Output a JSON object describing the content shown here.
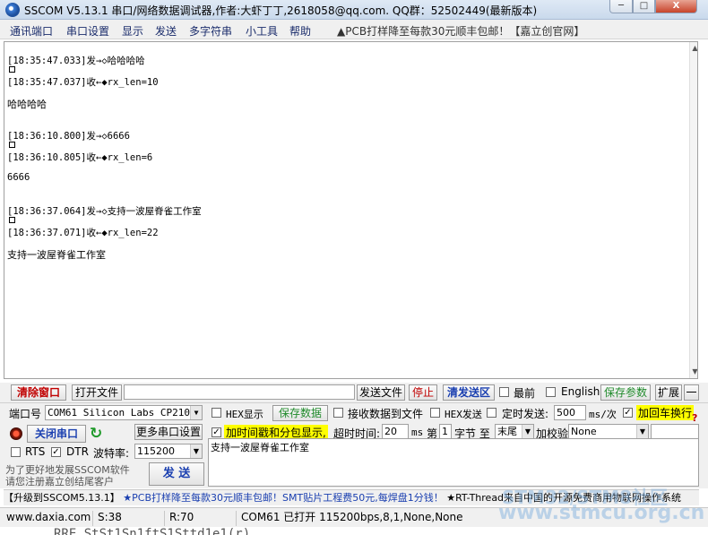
{
  "window": {
    "title": "SSCOM V5.13.1 串口/网络数据调试器,作者:大虾丁丁,2618058@qq.com. QQ群：52502449(最新版本)",
    "min_label": "─",
    "max_label": "□",
    "close_label": "X"
  },
  "menu": {
    "items": [
      "通讯端口",
      "串口设置",
      "显示",
      "发送",
      "多字符串",
      "小工具",
      "帮助"
    ],
    "promo": "▲PCB打样降至每款30元顺丰包邮！【嘉立创官网】"
  },
  "receive": {
    "lines": [
      "[18:35:47.033]发→◇哈哈哈哈",
      "[18:35:47.037]收←◆rx_len=10",
      "哈哈哈哈",
      "[18:36:10.800]发→◇6666",
      "[18:36:10.805]收←◆rx_len=6",
      "6666",
      "[18:36:37.064]发→◇支持一波屋脊雀工作室",
      "[18:36:37.071]收←◆rx_len=22",
      "支持一波屋脊雀工作室"
    ]
  },
  "toolbar": {
    "clear_window": "清除窗口",
    "open_file": "打开文件",
    "file_path": "",
    "send_file": "发送文件",
    "stop": "停止",
    "clear_send": "清发送区",
    "topmost": "最前",
    "english": "English",
    "save_params": "保存参数",
    "expand": "扩展",
    "collapse": "一"
  },
  "settings": {
    "port_label": "端口号",
    "port_value": "COM61 Silicon Labs CP210x",
    "hex_display": "HEX显示",
    "save_data": "保存数据",
    "recv_to_file": "接收数据到文件",
    "hex_send": "HEX发送",
    "timed_send": "定时发送:",
    "timed_interval": "500",
    "interval_unit": "ms/次",
    "add_crlf": "加回车换行",
    "close_port": "关闭串口",
    "more_settings": "更多串口设置",
    "timestamp_label": "加时间戳和分包显示,",
    "timeout_label": "超时时间:",
    "timeout_value": "20",
    "timeout_unit": "ms",
    "packet_prefix": "第",
    "packet_value": "1",
    "byte_label": "字节 至",
    "tail_value": "末尾",
    "checksum_label": "加校验",
    "checksum_value": "None",
    "rts": "RTS",
    "dtr": "DTR",
    "baud_label": "波特率:",
    "baud_value": "115200",
    "send_text": "支持一波屋脊雀工作室",
    "promo_line1": "为了更好地发展SSCOM软件",
    "promo_line2": "请您注册嘉立创结尾客户",
    "send_button": "发 送"
  },
  "marquee": {
    "part1": "【升级到SSCOM5.13.1】",
    "part2": "★PCB打样降至每款30元顺丰包邮！SMT贴片工程费50元,每焊盘1分钱！",
    "part3": "★RT-Thread来自中国的开源免费商用物联网操作系统"
  },
  "status": {
    "website": "www.daxia.com",
    "sent": "S:38",
    "received": "R:70",
    "port_status": "COM61 已打开  115200bps,8,1,None,None"
  },
  "overlay": {
    "watermark_top": "STM32/STM8社区",
    "watermark_url": "www.stmcu.org.cn",
    "underlying_code": "    RRE StSt1Sn1ftS1Sttd1e1(r)"
  }
}
